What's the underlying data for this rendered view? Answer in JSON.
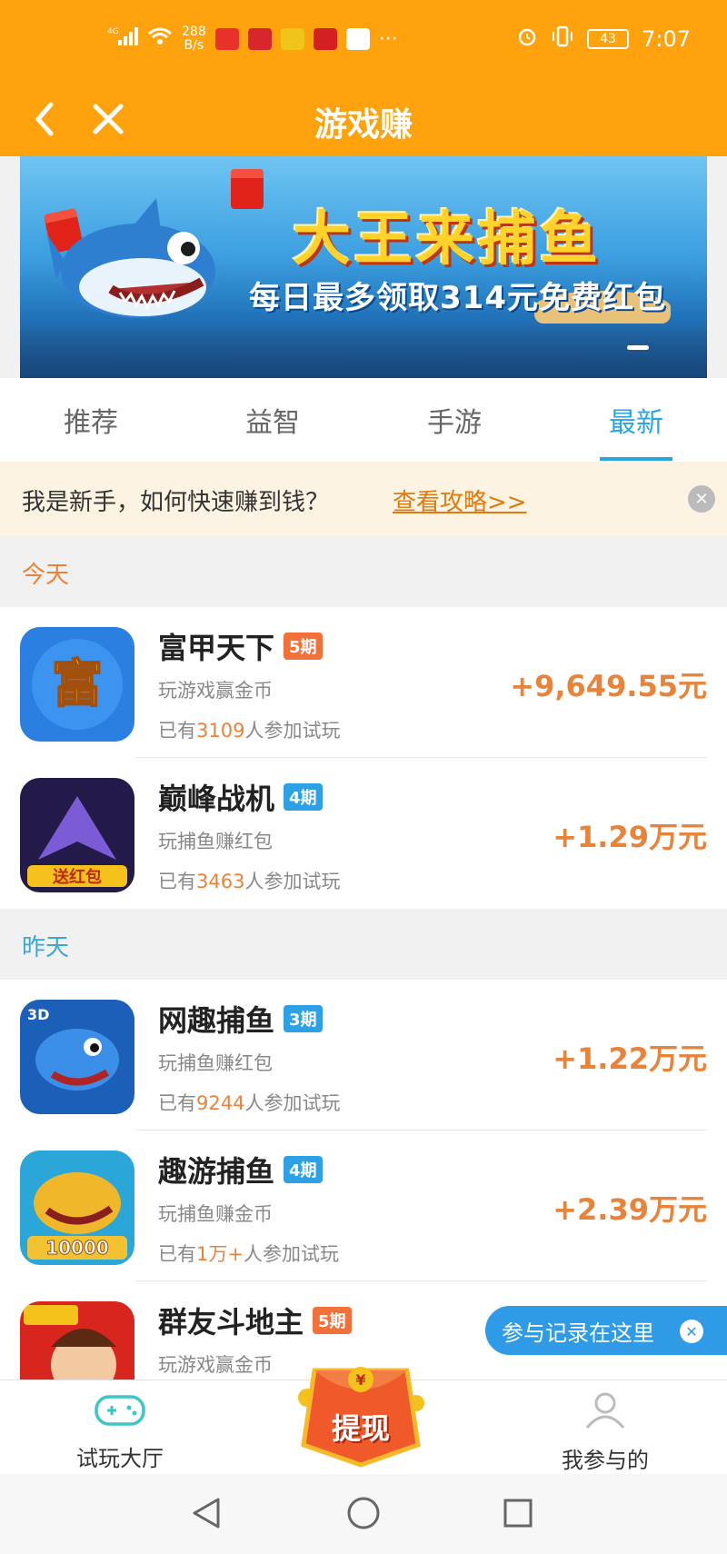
{
  "status_bar": {
    "signal": "4G",
    "speed_value": "288",
    "speed_unit": "B/s",
    "time": "7:07",
    "battery": "43"
  },
  "nav": {
    "title": "游戏赚",
    "back_icon": "back-arrow-icon",
    "close_icon": "close-icon"
  },
  "banner": {
    "title": "大王来捕鱼",
    "subtitle": "每日最多领取314元免费红包"
  },
  "tabs": [
    {
      "label": "推荐",
      "active": false
    },
    {
      "label": "益智",
      "active": false
    },
    {
      "label": "手游",
      "active": false
    },
    {
      "label": "最新",
      "active": true
    }
  ],
  "notice": {
    "text": "我是新手，如何快速赚到钱？",
    "link": "查看攻略>>"
  },
  "sections": {
    "today": "今天",
    "yesterday": "昨天"
  },
  "items": [
    {
      "name": "富甲天下",
      "badge": "5期",
      "desc": "玩游戏赢金币",
      "join_prefix": "已有",
      "join_count": "3109",
      "join_suffix": "人参加试玩",
      "reward": "+9,649.55元"
    },
    {
      "name": "巅峰战机",
      "badge": "4期",
      "desc": "玩捕鱼赚红包",
      "join_prefix": "已有",
      "join_count": "3463",
      "join_suffix": "人参加试玩",
      "reward": "+1.29万元"
    },
    {
      "name": "网趣捕鱼",
      "badge": "3期",
      "desc": "玩捕鱼赚红包",
      "join_prefix": "已有",
      "join_count": "9244",
      "join_suffix": "人参加试玩",
      "reward": "+1.22万元"
    },
    {
      "name": "趣游捕鱼",
      "badge": "4期",
      "desc": "玩捕鱼赚金币",
      "join_prefix": "已有",
      "join_count": "1万+",
      "join_suffix": "人参加试玩",
      "reward": "+2.39万元"
    },
    {
      "name": "群友斗地主",
      "badge": "5期",
      "desc": "玩游戏赢金币",
      "join_prefix": "",
      "join_count": "",
      "join_suffix": "",
      "reward": ""
    }
  ],
  "float_tip": {
    "text": "参与记录在这里"
  },
  "bottom_nav": {
    "lobby": "试玩大厅",
    "cash": "提现",
    "mine": "我参与的"
  },
  "colors": {
    "brand_orange": "#fea20d",
    "accent_blue": "#2ba5df",
    "reward_orange": "#e8833a"
  }
}
